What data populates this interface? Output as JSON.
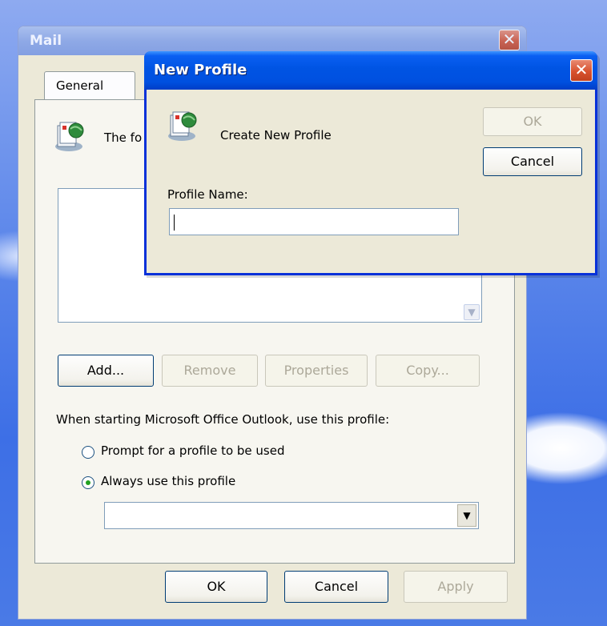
{
  "mail_window": {
    "title": "Mail",
    "tab_general": "General",
    "description_partial": "The fo",
    "buttons": {
      "add": "Add...",
      "remove": "Remove",
      "properties": "Properties",
      "copy": "Copy..."
    },
    "startup_label": "When starting Microsoft Office Outlook, use this profile:",
    "radio_prompt": "Prompt for a profile to be used",
    "radio_always": "Always use this profile",
    "radio_selected": "always",
    "profile_combo_value": "",
    "footer": {
      "ok": "OK",
      "cancel": "Cancel",
      "apply": "Apply"
    }
  },
  "new_profile_dialog": {
    "title": "New Profile",
    "heading": "Create New Profile",
    "ok": "OK",
    "cancel": "Cancel",
    "profile_name_label": "Profile Name:",
    "profile_name_value": ""
  },
  "icons": {
    "close": "close-icon",
    "profile": "mail-profile-icon",
    "dropdown": "chevron-down-icon"
  },
  "colors": {
    "xp_title_active": "#0054e3",
    "xp_title_inactive": "#8fa9e6",
    "dialog_face": "#ece9d8",
    "close_button": "#d8522f"
  }
}
